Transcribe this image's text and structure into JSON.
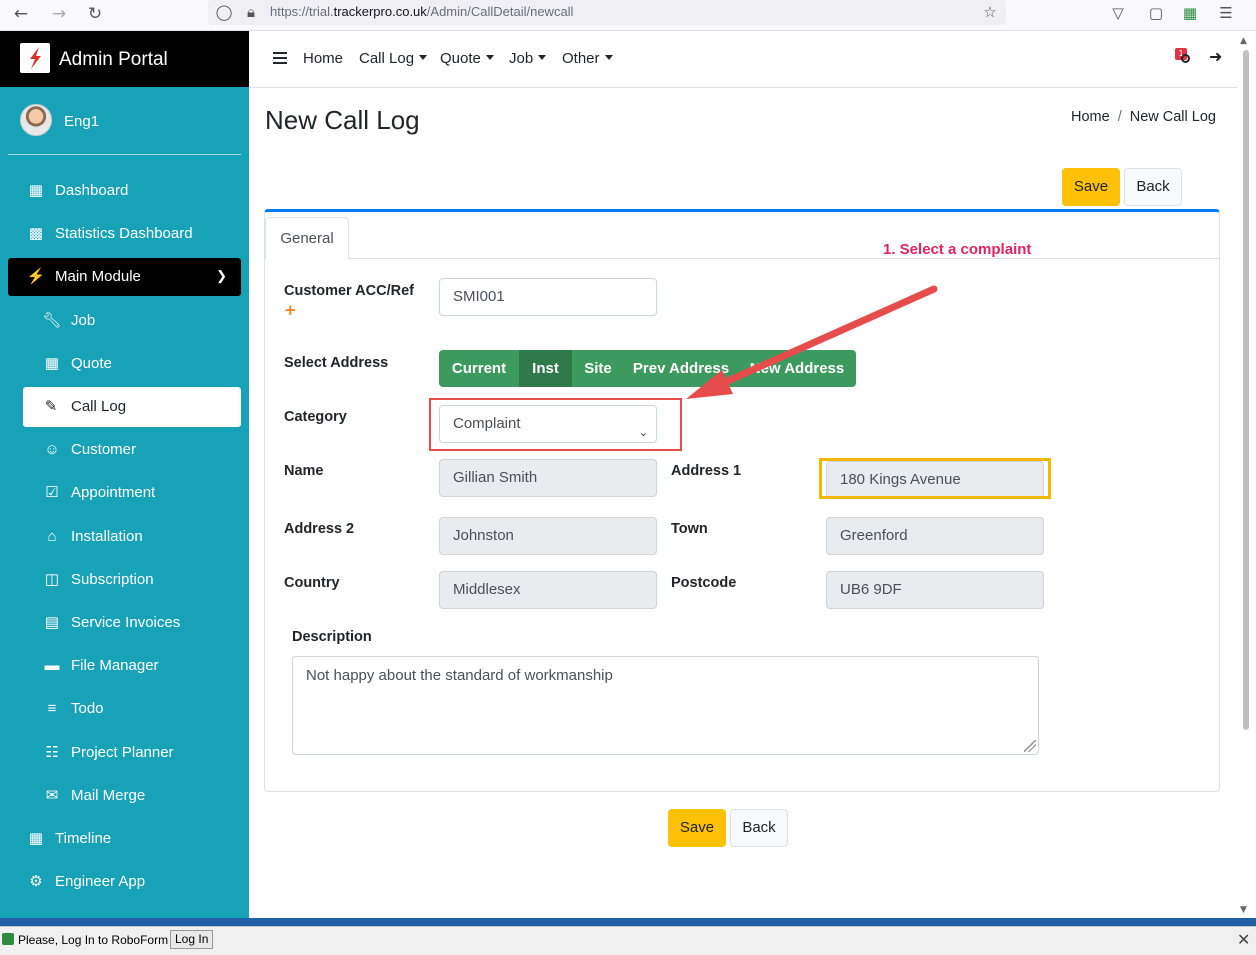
{
  "browser": {
    "url_prefix": "https://trial.",
    "url_domain": "trackerpro.co.uk",
    "url_path": "/Admin/CallDetail/newcall"
  },
  "sidebar": {
    "brand": "Admin Portal",
    "user": "Eng1",
    "items": [
      {
        "label": "Dashboard",
        "icon": "grid-icon"
      },
      {
        "label": "Statistics Dashboard",
        "icon": "bar-chart-icon"
      },
      {
        "label": "Main Module",
        "icon": "plug-icon"
      },
      {
        "label": "Job",
        "icon": "wrench-icon"
      },
      {
        "label": "Quote",
        "icon": "calculator-icon"
      },
      {
        "label": "Call Log",
        "icon": "user-edit-icon"
      },
      {
        "label": "Customer",
        "icon": "users-icon"
      },
      {
        "label": "Appointment",
        "icon": "calendar-check-icon"
      },
      {
        "label": "Installation",
        "icon": "home-icon"
      },
      {
        "label": "Subscription",
        "icon": "file-icon"
      },
      {
        "label": "Service Invoices",
        "icon": "file-text-icon"
      },
      {
        "label": "File Manager",
        "icon": "folder-icon"
      },
      {
        "label": "Todo",
        "icon": "list-icon"
      },
      {
        "label": "Project Planner",
        "icon": "sitemap-icon"
      },
      {
        "label": "Mail Merge",
        "icon": "mail-bulk-icon"
      },
      {
        "label": "Timeline",
        "icon": "calendar-icon"
      },
      {
        "label": "Engineer App",
        "icon": "users-cog-icon"
      }
    ]
  },
  "topnav": {
    "home": "Home",
    "call_log": "Call Log",
    "quote": "Quote",
    "job": "Job",
    "other": "Other",
    "notification_count": "1"
  },
  "page": {
    "title": "New Call Log",
    "breadcrumb_home": "Home",
    "breadcrumb_current": "New Call Log",
    "save_label": "Save",
    "back_label": "Back"
  },
  "tabs": {
    "general": "General"
  },
  "annotation": "1. Select a complaint",
  "form": {
    "customer_label": "Customer ACC/Ref",
    "required_mark": "+",
    "customer_value": "SMI001",
    "select_address_label": "Select Address",
    "address_buttons": [
      "Current",
      "Inst",
      "Site",
      "Prev Address",
      "New Address"
    ],
    "address_active_index": 1,
    "category_label": "Category",
    "category_value": "Complaint",
    "name_label": "Name",
    "name_value": "Gillian Smith",
    "address1_label": "Address 1",
    "address1_value": "180 Kings Avenue",
    "address2_label": "Address 2",
    "address2_value": "Johnston",
    "town_label": "Town",
    "town_value": "Greenford",
    "country_label": "Country",
    "country_value": "Middlesex",
    "postcode_label": "Postcode",
    "postcode_value": "UB6 9DF",
    "description_label": "Description",
    "description_value": "Not happy about the standard of workmanship"
  },
  "roboform": {
    "message": "Please, Log In to RoboForm",
    "button": "Log In"
  },
  "colors": {
    "sidebar": "#17a2b8",
    "primary_button": "#ffc107",
    "address_group": "#3d9a5f",
    "annotation": "#e0245e",
    "highlight_red": "#e74c4c",
    "highlight_yellow": "#f5b800"
  }
}
